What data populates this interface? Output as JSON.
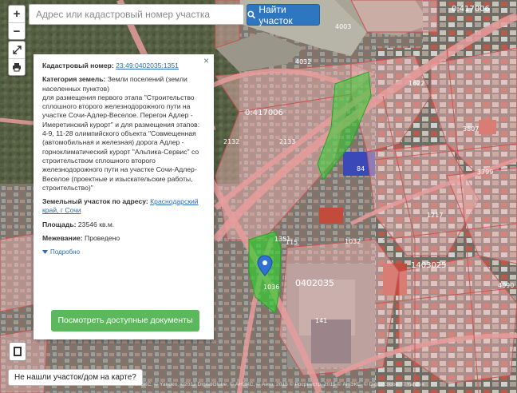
{
  "search": {
    "placeholder": "Адрес или кадастровый номер участка",
    "button_label": "Найти участок"
  },
  "controls": {
    "zoom_in": "+",
    "zoom_out": "−"
  },
  "parcel": {
    "cadastral_label": "Кадастровый номер:",
    "cadastral_number": "23:49:0402035:1351",
    "category_label": "Категория земель:",
    "category_value": "Земли поселений (земли населенных пунктов)",
    "purpose_text": "для размещения первого этапа \"Строительство сплошного второго железнодорожного пути на участке Сочи-Адлер-Веселое. Перегон Адлер - Имеретинский курорт\" и для размещения этапов: 4-9, 11-28 олимпийского объекта \"Совмещенная (автомобильная и железная) дорога Адлер - горноклиматический курорт \"Альпика-Сервис\" со строительством сплошного второго железнодорожного пути на участке Сочи-Адлер-Веселое (проектные и изыскательские работы, строительство)\"",
    "address_label": "Земельный участок по адресу:",
    "address_value": "Краснодарский край, г Сочи",
    "area_label": "Площадь:",
    "area_value": "23546 кв.м.",
    "survey_label": "Межевание:",
    "survey_value": "Проведено",
    "more_label": "Подробно",
    "docs_button": "Посмотреть доступные документы",
    "close": "×"
  },
  "bottom": {
    "not_found": "Не нашли участок/дом на карте?",
    "attribution": "© АНЭКС, © Yandex, ©2012 DigitalGlobe, © АНЭКС, © Aero, 2015 © Росреестр, 2015 © АНЭКС, © DigitalGlobe, © Yandex"
  },
  "map": {
    "labels": {
      "quarter_top": "0:417006",
      "quarter_mid": "0:417006",
      "block_0402035": "0402035",
      "block_1403025": "1403025",
      "num_4003": "4003",
      "num_4032": "4032",
      "num_1622": "1622",
      "num_2133": "2133",
      "num_3807": "3807",
      "num_3799": "3799",
      "num_1217": "1217",
      "num_1032": "1032",
      "num_4090": "4090",
      "num_141": "141",
      "num_115": "115",
      "num_84": "84",
      "num_2132": "2132",
      "num_1351": "1351",
      "num_1036": "1036"
    }
  },
  "colors": {
    "parcel_fill": "#f3b8b8",
    "parcel_stroke": "#c95555",
    "highlight": "#2fd12f",
    "search_button": "#2e76bf",
    "docs_button": "#5cb85c",
    "marker": "#2f6fd6"
  }
}
